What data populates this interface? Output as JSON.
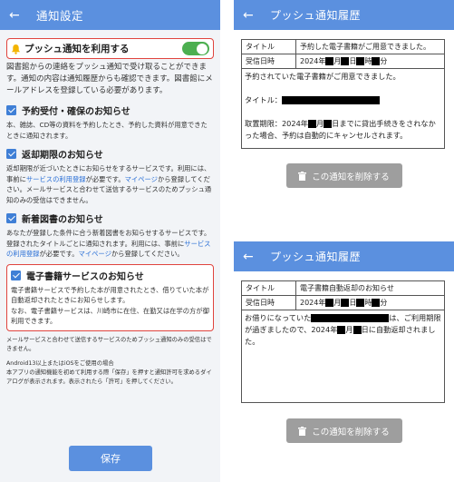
{
  "left": {
    "header": {
      "back": "←",
      "title": "通知設定"
    },
    "push": {
      "label": "プッシュ通知を利用する",
      "enabled": true,
      "description": "図書館からの連絡をプッシュ通知で受け取ることができます。通知の内容は通知履歴からも確認できます。図書館にメールアドレスを登録している必要があります。"
    },
    "items": [
      {
        "label": "予約受付・確保のお知らせ",
        "checked": true,
        "desc": "本、雑誌、CD等の資料を予約したとき、予約した資料が用意できたときに通知されます。"
      },
      {
        "label": "返却期限のお知らせ",
        "checked": true,
        "desc_a": "返却期限が近づいたときにお知らせをするサービスです。利用には、事前に",
        "desc_link1": "サービスの利用登録",
        "desc_b": "が必要です。",
        "desc_link2": "マイページ",
        "desc_c": "から登録してください。メールサービスと合わせて送信するサービスのためプッシュ通知のみの受信はできません。"
      },
      {
        "label": "新着図書のお知らせ",
        "checked": true,
        "desc_a": "あなたが登録した条件に合う新着図書をお知らせするサービスです。登録されたタイトルごとに通知されます。利用には、事前に",
        "desc_link1": "サービスの利用登録",
        "desc_b": "が必要です。",
        "desc_link2": "マイページ",
        "desc_c": "から登録してください。"
      },
      {
        "label": "電子書籍サービスのお知らせ",
        "checked": true,
        "desc1": "電子書籍サービスで予約した本が用意されたとき、借りていた本が自動返却されたときにお知らせします。",
        "desc2": "なお、電子書籍サービスは、川崎市に在住、在勤又は在学の方が御利用できます。"
      }
    ],
    "note1": "メールサービスと合わせて送信するサービスのためプッシュ通知のみの受信はできません。",
    "note2": "Android13以上またはiOSをご使用の場合",
    "note3": "本アプリの通知機能を初めて利用する際「保存」を押すと通知許可を求めるダイアログが表示されます。表示されたら「許可」を押してください。",
    "save_label": "保存"
  },
  "history1": {
    "header": {
      "back": "←",
      "title": "プッシュ通知履歴"
    },
    "title_key": "タイトル",
    "title_value": "予約した電子書籍がご用意できました。",
    "date_key": "受信日時",
    "date_value": [
      "2024年",
      "月",
      "日",
      "時",
      "分"
    ],
    "body1": "予約されていた電子書籍がご用意できました。",
    "body2": "タイトル：",
    "body3a": "取置期限：2024年",
    "body3b": "月",
    "body3c": "日までに貸出手続きをされなかった場合、予約は自動的にキャンセルされます。",
    "delete_label": "この通知を削除する"
  },
  "history2": {
    "header": {
      "back": "←",
      "title": "プッシュ通知履歴"
    },
    "title_key": "タイトル",
    "title_value": "電子書籍自動返却のお知らせ",
    "date_key": "受信日時",
    "date_value": [
      "2024年",
      "月",
      "日",
      "時",
      "分"
    ],
    "body1a": "お借りになっていた",
    "body1b": "は、ご利用期限が過ぎましたので、2024年",
    "body1c": "月",
    "body1d": "日に自動返却されました。",
    "delete_label": "この通知を削除する"
  },
  "colors": {
    "appbar": "#5b90df",
    "highlight": "#e0443e",
    "toggle_on": "#4caf50",
    "checkbox": "#3f7fd6",
    "link": "#2a6fd6",
    "delete_button": "#9e9e9e"
  }
}
